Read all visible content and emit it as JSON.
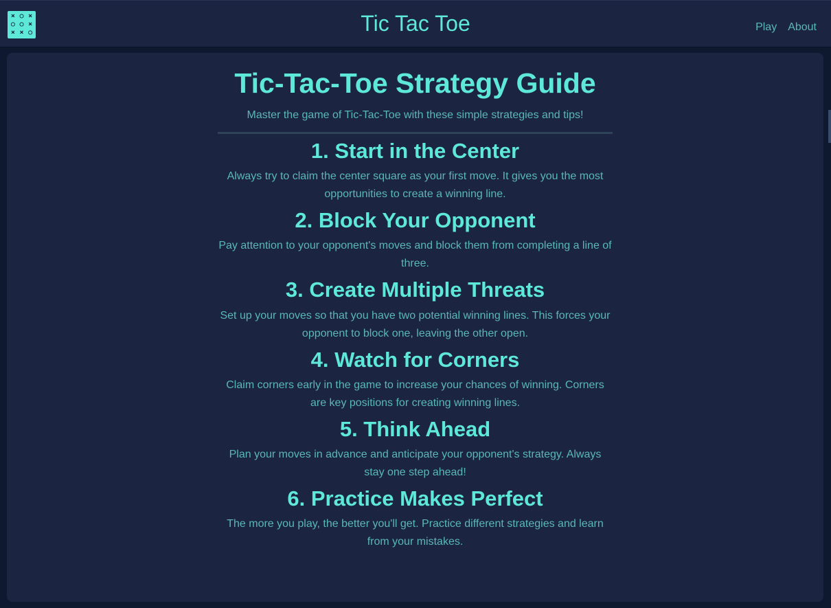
{
  "header": {
    "title": "Tic Tac Toe",
    "logo_cells": [
      "×",
      "○",
      "×",
      "○",
      "○",
      "×",
      "×",
      "×",
      "○"
    ],
    "nav": [
      {
        "label": "Play"
      },
      {
        "label": "About"
      }
    ]
  },
  "main": {
    "title": "Tic-Tac-Toe Strategy Guide",
    "subtitle": "Master the game of Tic-Tac-Toe with these simple strategies and tips!",
    "sections": [
      {
        "heading": "1. Start in the Center",
        "text": "Always try to claim the center square as your first move. It gives you the most opportunities to create a winning line."
      },
      {
        "heading": "2. Block Your Opponent",
        "text": "Pay attention to your opponent's moves and block them from completing a line of three."
      },
      {
        "heading": "3. Create Multiple Threats",
        "text": "Set up your moves so that you have two potential winning lines. This forces your opponent to block one, leaving the other open."
      },
      {
        "heading": "4. Watch for Corners",
        "text": "Claim corners early in the game to increase your chances of winning. Corners are key positions for creating winning lines."
      },
      {
        "heading": "5. Think Ahead",
        "text": "Plan your moves in advance and anticipate your opponent's strategy. Always stay one step ahead!"
      },
      {
        "heading": "6. Practice Makes Perfect",
        "text": "The more you play, the better you'll get. Practice different strategies and learn from your mistakes."
      }
    ]
  },
  "colors": {
    "accent": "#5ee8d8",
    "text": "#5ab8b8",
    "panel": "#1b2440",
    "background": "#0e1930"
  }
}
